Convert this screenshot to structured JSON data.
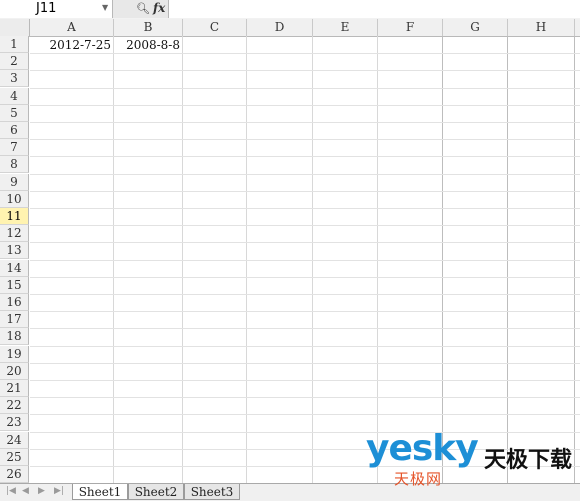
{
  "formula_bar": {
    "name_box": "J11",
    "formula": ""
  },
  "columns": [
    "A",
    "B",
    "C",
    "D",
    "E",
    "F",
    "G",
    "H"
  ],
  "rows": [
    "1",
    "2",
    "3",
    "4",
    "5",
    "6",
    "7",
    "8",
    "9",
    "10",
    "11",
    "12",
    "13",
    "14",
    "15",
    "16",
    "17",
    "18",
    "19",
    "20",
    "21",
    "22",
    "23",
    "24",
    "25",
    "26"
  ],
  "active_row": "11",
  "cells": {
    "A1": "2012-7-25",
    "B1": "2008-8-8"
  },
  "sheet_tabs": [
    "Sheet1",
    "Sheet2",
    "Sheet3"
  ],
  "active_sheet": "Sheet1",
  "watermark": {
    "brand": "yesky",
    "brand_cn": "天极下载",
    "sub_cn": "天极网"
  },
  "colors": {
    "active_row_header": "#fff3b0",
    "brand_blue": "#1d8fd6",
    "brand_orange": "#e5542a"
  },
  "icons": {
    "name_box_dropdown": "chevron-down-icon",
    "zoom": "magnifier-icon",
    "function": "fx-icon"
  }
}
